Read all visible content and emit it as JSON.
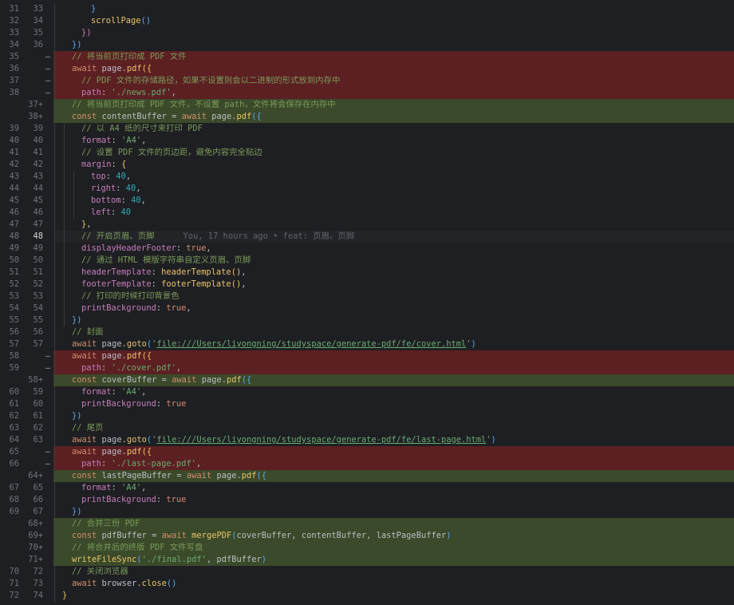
{
  "editor": {
    "blame_hint": "You, 17 hours ago • feat: 页眉、页脚",
    "lines": [
      {
        "old": "31",
        "new": "33",
        "kind": "ctx",
        "indent": 3,
        "tokens": [
          [
            "brk3",
            "}"
          ]
        ]
      },
      {
        "old": "32",
        "new": "34",
        "kind": "ctx",
        "indent": 3,
        "tokens": [
          [
            "fn",
            "scrollPage"
          ],
          [
            "brk3",
            "()"
          ]
        ]
      },
      {
        "old": "33",
        "new": "35",
        "kind": "ctx",
        "indent": 2,
        "tokens": [
          [
            "brk2",
            "})"
          ]
        ]
      },
      {
        "old": "34",
        "new": "36",
        "kind": "ctx",
        "indent": 1,
        "tokens": [
          [
            "brk3",
            "})"
          ]
        ]
      },
      {
        "old": "35",
        "new": "",
        "kind": "del",
        "indent": 1,
        "tokens": [
          [
            "cmt",
            "// 将当前页打印成 PDF 文件"
          ]
        ]
      },
      {
        "old": "36",
        "new": "",
        "kind": "del",
        "indent": 1,
        "tokens": [
          [
            "kw",
            "await "
          ],
          [
            "var",
            "page."
          ],
          [
            "fn",
            "pdf"
          ],
          [
            "brk1",
            "({"
          ]
        ]
      },
      {
        "old": "37",
        "new": "",
        "kind": "del",
        "indent": 2,
        "tokens": [
          [
            "cmt",
            "// PDF 文件的存储路径，如果不设置则会以二进制的形式放到内存中"
          ]
        ]
      },
      {
        "old": "38",
        "new": "",
        "kind": "del",
        "indent": 2,
        "tokens": [
          [
            "prop",
            "path"
          ],
          [
            "punc",
            ": "
          ],
          [
            "str",
            "'./news.pdf'"
          ],
          [
            "punc",
            ","
          ]
        ]
      },
      {
        "old": "",
        "new": "37+",
        "kind": "add",
        "indent": 1,
        "tokens": [
          [
            "cmt",
            "// 将当前页打印成 PDF 文件，不设置 path，文件将会保存在内存中"
          ]
        ]
      },
      {
        "old": "",
        "new": "38+",
        "kind": "add",
        "indent": 1,
        "tokens": [
          [
            "kw",
            "const "
          ],
          [
            "var",
            "contentBuffer = "
          ],
          [
            "kw",
            "await "
          ],
          [
            "var",
            "page."
          ],
          [
            "fn",
            "pdf"
          ],
          [
            "brk3",
            "({"
          ]
        ]
      },
      {
        "old": "39",
        "new": "39",
        "kind": "ctx",
        "indent": 2,
        "tokens": [
          [
            "cmt",
            "// 以 A4 纸的尺寸来打印 PDF"
          ]
        ]
      },
      {
        "old": "40",
        "new": "40",
        "kind": "ctx",
        "indent": 2,
        "tokens": [
          [
            "prop",
            "format"
          ],
          [
            "punc",
            ": "
          ],
          [
            "str",
            "'A4'"
          ],
          [
            "punc",
            ","
          ]
        ]
      },
      {
        "old": "41",
        "new": "41",
        "kind": "ctx",
        "indent": 2,
        "tokens": [
          [
            "cmt",
            "// 设置 PDF 文件的页边距，避免内容完全贴边"
          ]
        ]
      },
      {
        "old": "42",
        "new": "42",
        "kind": "ctx",
        "indent": 2,
        "tokens": [
          [
            "prop",
            "margin"
          ],
          [
            "punc",
            ": "
          ],
          [
            "brk1",
            "{"
          ]
        ]
      },
      {
        "old": "43",
        "new": "43",
        "kind": "ctx",
        "indent": 3,
        "tokens": [
          [
            "prop",
            "top"
          ],
          [
            "punc",
            ": "
          ],
          [
            "num",
            "40"
          ],
          [
            "punc",
            ","
          ]
        ]
      },
      {
        "old": "44",
        "new": "44",
        "kind": "ctx",
        "indent": 3,
        "tokens": [
          [
            "prop",
            "right"
          ],
          [
            "punc",
            ": "
          ],
          [
            "num",
            "40"
          ],
          [
            "punc",
            ","
          ]
        ]
      },
      {
        "old": "45",
        "new": "45",
        "kind": "ctx",
        "indent": 3,
        "tokens": [
          [
            "prop",
            "bottom"
          ],
          [
            "punc",
            ": "
          ],
          [
            "num",
            "40"
          ],
          [
            "punc",
            ","
          ]
        ]
      },
      {
        "old": "46",
        "new": "46",
        "kind": "ctx",
        "indent": 3,
        "tokens": [
          [
            "prop",
            "left"
          ],
          [
            "punc",
            ": "
          ],
          [
            "num",
            "40"
          ]
        ]
      },
      {
        "old": "47",
        "new": "47",
        "kind": "ctx",
        "indent": 2,
        "tokens": [
          [
            "brk1",
            "}"
          ],
          [
            "punc",
            ","
          ]
        ]
      },
      {
        "old": "48",
        "new": "48",
        "kind": "cur",
        "indent": 2,
        "tokens": [
          [
            "cmt",
            "// 开启页眉、页脚"
          ]
        ],
        "hint": true
      },
      {
        "old": "49",
        "new": "49",
        "kind": "ctx",
        "indent": 2,
        "tokens": [
          [
            "prop",
            "displayHeaderFooter"
          ],
          [
            "punc",
            ": "
          ],
          [
            "kw",
            "true"
          ],
          [
            "punc",
            ","
          ]
        ]
      },
      {
        "old": "50",
        "new": "50",
        "kind": "ctx",
        "indent": 2,
        "tokens": [
          [
            "cmt",
            "// 通过 HTML 模版字符串自定义页眉、页脚"
          ]
        ]
      },
      {
        "old": "51",
        "new": "51",
        "kind": "ctx",
        "indent": 2,
        "tokens": [
          [
            "prop",
            "headerTemplate"
          ],
          [
            "punc",
            ": "
          ],
          [
            "fn",
            "headerTemplate"
          ],
          [
            "brk1",
            "()"
          ],
          [
            "punc",
            ","
          ]
        ]
      },
      {
        "old": "52",
        "new": "52",
        "kind": "ctx",
        "indent": 2,
        "tokens": [
          [
            "prop",
            "footerTemplate"
          ],
          [
            "punc",
            ": "
          ],
          [
            "fn",
            "footerTemplate"
          ],
          [
            "brk1",
            "()"
          ],
          [
            "punc",
            ","
          ]
        ]
      },
      {
        "old": "53",
        "new": "53",
        "kind": "ctx",
        "indent": 2,
        "tokens": [
          [
            "cmt",
            "// 打印的时候打印背景色"
          ]
        ]
      },
      {
        "old": "54",
        "new": "54",
        "kind": "ctx",
        "indent": 2,
        "tokens": [
          [
            "prop",
            "printBackground"
          ],
          [
            "punc",
            ": "
          ],
          [
            "kw",
            "true"
          ],
          [
            "punc",
            ","
          ]
        ]
      },
      {
        "old": "55",
        "new": "55",
        "kind": "ctx",
        "indent": 1,
        "tokens": [
          [
            "brk3",
            "})"
          ]
        ]
      },
      {
        "old": "56",
        "new": "56",
        "kind": "ctx",
        "indent": 1,
        "tokens": [
          [
            "cmt",
            "// 封面"
          ]
        ]
      },
      {
        "old": "57",
        "new": "57",
        "kind": "ctx",
        "indent": 1,
        "tokens": [
          [
            "kw",
            "await "
          ],
          [
            "var",
            "page."
          ],
          [
            "fn",
            "goto"
          ],
          [
            "brk3",
            "("
          ],
          [
            "str",
            "'"
          ],
          [
            "url",
            "file:///Users/liyongning/studyspace/generate-pdf/fe/cover.html"
          ],
          [
            "str",
            "'"
          ],
          [
            "brk3",
            ")"
          ]
        ]
      },
      {
        "old": "58",
        "new": "",
        "kind": "del",
        "indent": 1,
        "tokens": [
          [
            "kw",
            "await "
          ],
          [
            "var",
            "page."
          ],
          [
            "fn",
            "pdf"
          ],
          [
            "brk1",
            "({"
          ]
        ]
      },
      {
        "old": "59",
        "new": "",
        "kind": "del",
        "indent": 2,
        "tokens": [
          [
            "prop",
            "path"
          ],
          [
            "punc",
            ": "
          ],
          [
            "str",
            "'./cover.pdf'"
          ],
          [
            "punc",
            ","
          ]
        ]
      },
      {
        "old": "",
        "new": "58+",
        "kind": "add",
        "indent": 1,
        "tokens": [
          [
            "kw",
            "const "
          ],
          [
            "var",
            "coverBuffer = "
          ],
          [
            "kw",
            "await "
          ],
          [
            "var",
            "page."
          ],
          [
            "fn",
            "pdf"
          ],
          [
            "brk3",
            "({"
          ]
        ]
      },
      {
        "old": "60",
        "new": "59",
        "kind": "ctx",
        "indent": 2,
        "tokens": [
          [
            "prop",
            "format"
          ],
          [
            "punc",
            ": "
          ],
          [
            "str",
            "'A4'"
          ],
          [
            "punc",
            ","
          ]
        ]
      },
      {
        "old": "61",
        "new": "60",
        "kind": "ctx",
        "indent": 2,
        "tokens": [
          [
            "prop",
            "printBackground"
          ],
          [
            "punc",
            ": "
          ],
          [
            "kw",
            "true"
          ]
        ]
      },
      {
        "old": "62",
        "new": "61",
        "kind": "ctx",
        "indent": 1,
        "tokens": [
          [
            "brk3",
            "})"
          ]
        ]
      },
      {
        "old": "63",
        "new": "62",
        "kind": "ctx",
        "indent": 1,
        "tokens": [
          [
            "cmt",
            "// 尾页"
          ]
        ]
      },
      {
        "old": "64",
        "new": "63",
        "kind": "ctx",
        "indent": 1,
        "tokens": [
          [
            "kw",
            "await "
          ],
          [
            "var",
            "page."
          ],
          [
            "fn",
            "goto"
          ],
          [
            "brk3",
            "("
          ],
          [
            "str",
            "'"
          ],
          [
            "url",
            "file:///Users/liyongning/studyspace/generate-pdf/fe/last-page.html"
          ],
          [
            "str",
            "'"
          ],
          [
            "brk3",
            ")"
          ]
        ]
      },
      {
        "old": "65",
        "new": "",
        "kind": "del",
        "indent": 1,
        "tokens": [
          [
            "kw",
            "await "
          ],
          [
            "var",
            "page."
          ],
          [
            "fn",
            "pdf"
          ],
          [
            "brk1",
            "({"
          ]
        ]
      },
      {
        "old": "66",
        "new": "",
        "kind": "del",
        "indent": 2,
        "tokens": [
          [
            "prop",
            "path"
          ],
          [
            "punc",
            ": "
          ],
          [
            "str",
            "'./last-page.pdf'"
          ],
          [
            "punc",
            ","
          ]
        ]
      },
      {
        "old": "",
        "new": "64+",
        "kind": "add",
        "indent": 1,
        "tokens": [
          [
            "kw",
            "const "
          ],
          [
            "var",
            "lastPageBuffer = "
          ],
          [
            "kw",
            "await "
          ],
          [
            "var",
            "page."
          ],
          [
            "fn",
            "pdf"
          ],
          [
            "brk3",
            "({"
          ]
        ]
      },
      {
        "old": "67",
        "new": "65",
        "kind": "ctx",
        "indent": 2,
        "tokens": [
          [
            "prop",
            "format"
          ],
          [
            "punc",
            ": "
          ],
          [
            "str",
            "'A4'"
          ],
          [
            "punc",
            ","
          ]
        ]
      },
      {
        "old": "68",
        "new": "66",
        "kind": "ctx",
        "indent": 2,
        "tokens": [
          [
            "prop",
            "printBackground"
          ],
          [
            "punc",
            ": "
          ],
          [
            "kw",
            "true"
          ]
        ]
      },
      {
        "old": "69",
        "new": "67",
        "kind": "ctx",
        "indent": 1,
        "tokens": [
          [
            "brk3",
            "})"
          ]
        ]
      },
      {
        "old": "",
        "new": "68+",
        "kind": "add",
        "indent": 1,
        "tokens": [
          [
            "cmt",
            "// 合并三份 PDF"
          ]
        ]
      },
      {
        "old": "",
        "new": "69+",
        "kind": "add",
        "indent": 1,
        "tokens": [
          [
            "kw",
            "const "
          ],
          [
            "var",
            "pdfBuffer = "
          ],
          [
            "kw",
            "await "
          ],
          [
            "fn",
            "mergePDF"
          ],
          [
            "brk3",
            "("
          ],
          [
            "var",
            "coverBuffer, contentBuffer, lastPageBuffer"
          ],
          [
            "brk3",
            ")"
          ]
        ]
      },
      {
        "old": "",
        "new": "70+",
        "kind": "add",
        "indent": 1,
        "tokens": [
          [
            "cmt",
            "// 将合并后的终版 PDF 文件写盘"
          ]
        ]
      },
      {
        "old": "",
        "new": "71+",
        "kind": "add",
        "indent": 1,
        "tokens": [
          [
            "fn",
            "writeFileSync"
          ],
          [
            "brk3",
            "("
          ],
          [
            "str",
            "'./final.pdf'"
          ],
          [
            "punc",
            ", "
          ],
          [
            "var",
            "pdfBuffer"
          ],
          [
            "brk3",
            ")"
          ]
        ]
      },
      {
        "old": "70",
        "new": "72",
        "kind": "ctx",
        "indent": 1,
        "tokens": [
          [
            "cmt",
            "// 关闭浏览器"
          ]
        ]
      },
      {
        "old": "71",
        "new": "73",
        "kind": "ctx",
        "indent": 1,
        "tokens": [
          [
            "kw",
            "await "
          ],
          [
            "var",
            "browser."
          ],
          [
            "fn",
            "close"
          ],
          [
            "brk3",
            "()"
          ]
        ]
      },
      {
        "old": "72",
        "new": "74",
        "kind": "ctx",
        "indent": 0,
        "tokens": [
          [
            "brk1",
            "}"
          ]
        ]
      }
    ]
  }
}
